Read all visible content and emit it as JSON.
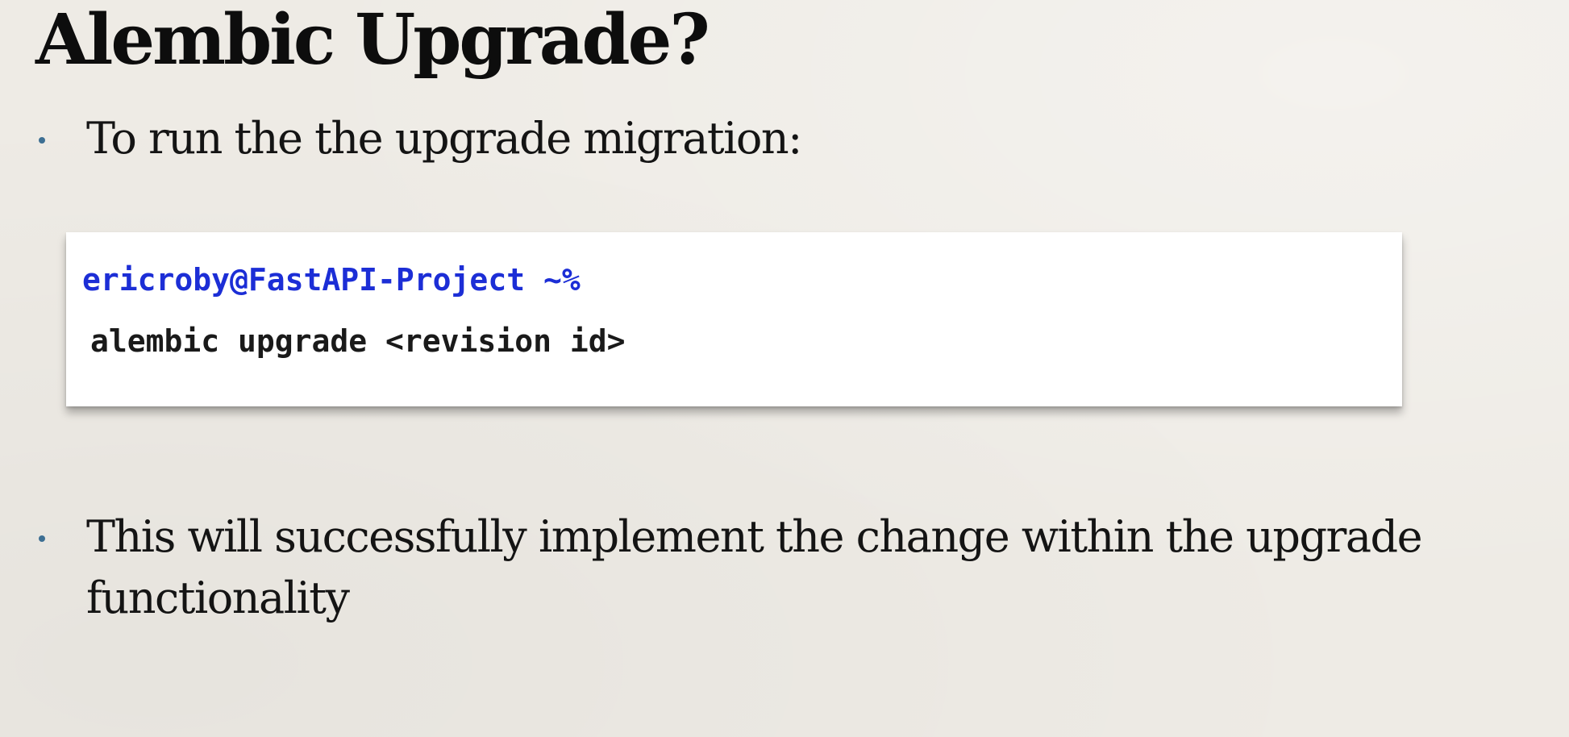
{
  "slide": {
    "title": "Alembic Upgrade?",
    "bullets": [
      {
        "text": "To run the the upgrade migration:"
      },
      {
        "text": "This will successfully implement the change within the upgrade functionality"
      }
    ],
    "terminal": {
      "prompt": "ericroby@FastAPI-Project ~%",
      "command": "alembic upgrade <revision id>"
    }
  },
  "colors": {
    "background": "#eeebe5",
    "bullet_dot": "#3d6f93",
    "prompt_text": "#1c2ed6",
    "command_text": "#1a1a1a"
  }
}
